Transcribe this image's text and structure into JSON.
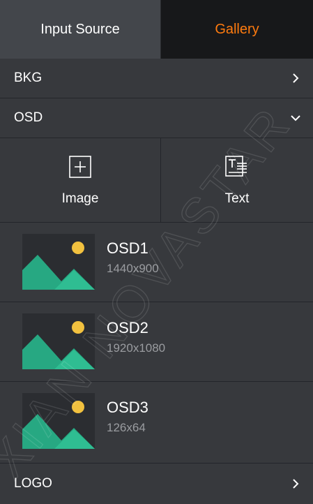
{
  "tabs": [
    {
      "label": "Input Source",
      "active": false
    },
    {
      "label": "Gallery",
      "active": true
    }
  ],
  "sections": {
    "bkg": {
      "label": "BKG",
      "state": "collapsed"
    },
    "osd": {
      "label": "OSD",
      "state": "expanded"
    },
    "logo": {
      "label": "LOGO",
      "state": "collapsed"
    }
  },
  "add_buttons": {
    "image_label": "Image",
    "text_label": "Text"
  },
  "osd_items": [
    {
      "name": "OSD1",
      "resolution": "1440x900"
    },
    {
      "name": "OSD2",
      "resolution": "1920x1080"
    },
    {
      "name": "OSD3",
      "resolution": "126x64"
    }
  ],
  "watermark": "XIAN NOVASTAR",
  "colors": {
    "panel_bg": "#37393d",
    "tab_active_bg": "#17181a",
    "tab_active_text": "#ff7b0f",
    "thumb_bg": "#2b2d31",
    "thumb_mountain": "#27a882",
    "thumb_sun": "#f2c13f",
    "secondary_text": "#9a9ca0"
  }
}
